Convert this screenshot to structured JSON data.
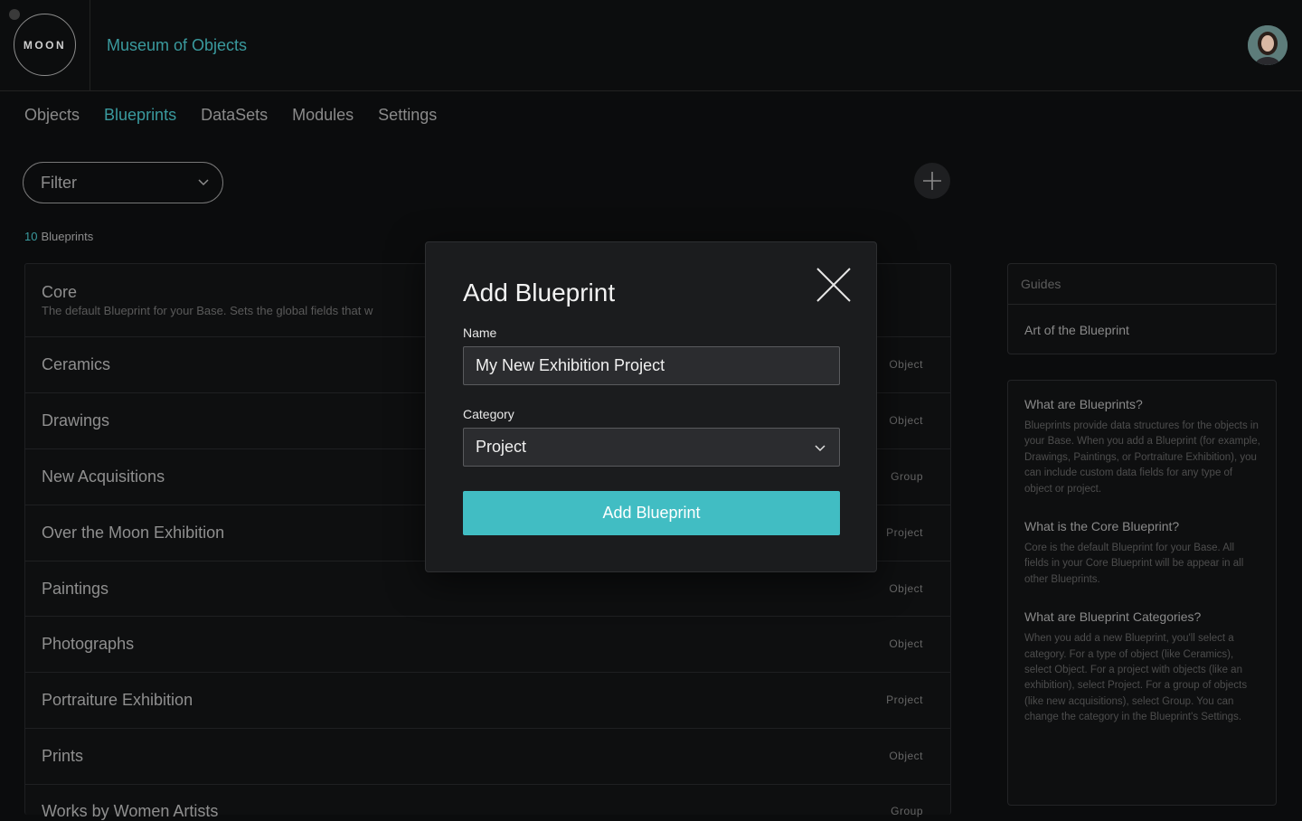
{
  "header": {
    "logo_text": "MOON",
    "org_name": "Museum of Objects"
  },
  "nav": {
    "tabs": [
      {
        "label": "Objects"
      },
      {
        "label": "Blueprints"
      },
      {
        "label": "DataSets"
      },
      {
        "label": "Modules"
      },
      {
        "label": "Settings"
      }
    ]
  },
  "filter": {
    "label": "Filter"
  },
  "count": {
    "number": "10",
    "label": "Blueprints"
  },
  "blueprints": [
    {
      "name": "Core",
      "category": "",
      "description": "The default Blueprint for your Base. Sets the global fields that w"
    },
    {
      "name": "Ceramics",
      "category": "Object"
    },
    {
      "name": "Drawings",
      "category": "Object"
    },
    {
      "name": "New Acquisitions",
      "category": "Group"
    },
    {
      "name": "Over the Moon Exhibition",
      "category": "Project"
    },
    {
      "name": "Paintings",
      "category": "Object"
    },
    {
      "name": "Photographs",
      "category": "Object"
    },
    {
      "name": "Portraiture Exhibition",
      "category": "Project"
    },
    {
      "name": "Prints",
      "category": "Object"
    },
    {
      "name": "Works by Women Artists",
      "category": "Group"
    }
  ],
  "guides": {
    "heading": "Guides",
    "items": [
      {
        "label": "Art of the Blueprint"
      }
    ]
  },
  "faq": [
    {
      "q": "What are Blueprints?",
      "a": "Blueprints provide data structures for the objects in your Base. When you add a Blueprint (for example, Drawings, Paintings, or Portraiture Exhibition), you can include custom data fields for any type of object or project."
    },
    {
      "q": "What is the Core Blueprint?",
      "a": "Core is the default Blueprint for your Base. All fields in your Core Blueprint will be appear in all other Blueprints."
    },
    {
      "q": "What are Blueprint Categories?",
      "a": "When you add a new Blueprint, you'll select a category. For a type of object (like Ceramics), select Object. For a project with objects (like an exhibition), select Project. For a group of objects (like new acquisitions), select Group. You can change the category in the Blueprint's Settings."
    }
  ],
  "modal": {
    "title": "Add Blueprint",
    "name_label": "Name",
    "name_value": "My New Exhibition Project",
    "category_label": "Category",
    "category_value": "Project",
    "submit_label": "Add Blueprint"
  },
  "colors": {
    "accent": "#3a9a9e",
    "button": "#41bdc3",
    "background": "#0b0c0d",
    "modal": "#1b1c1e"
  }
}
